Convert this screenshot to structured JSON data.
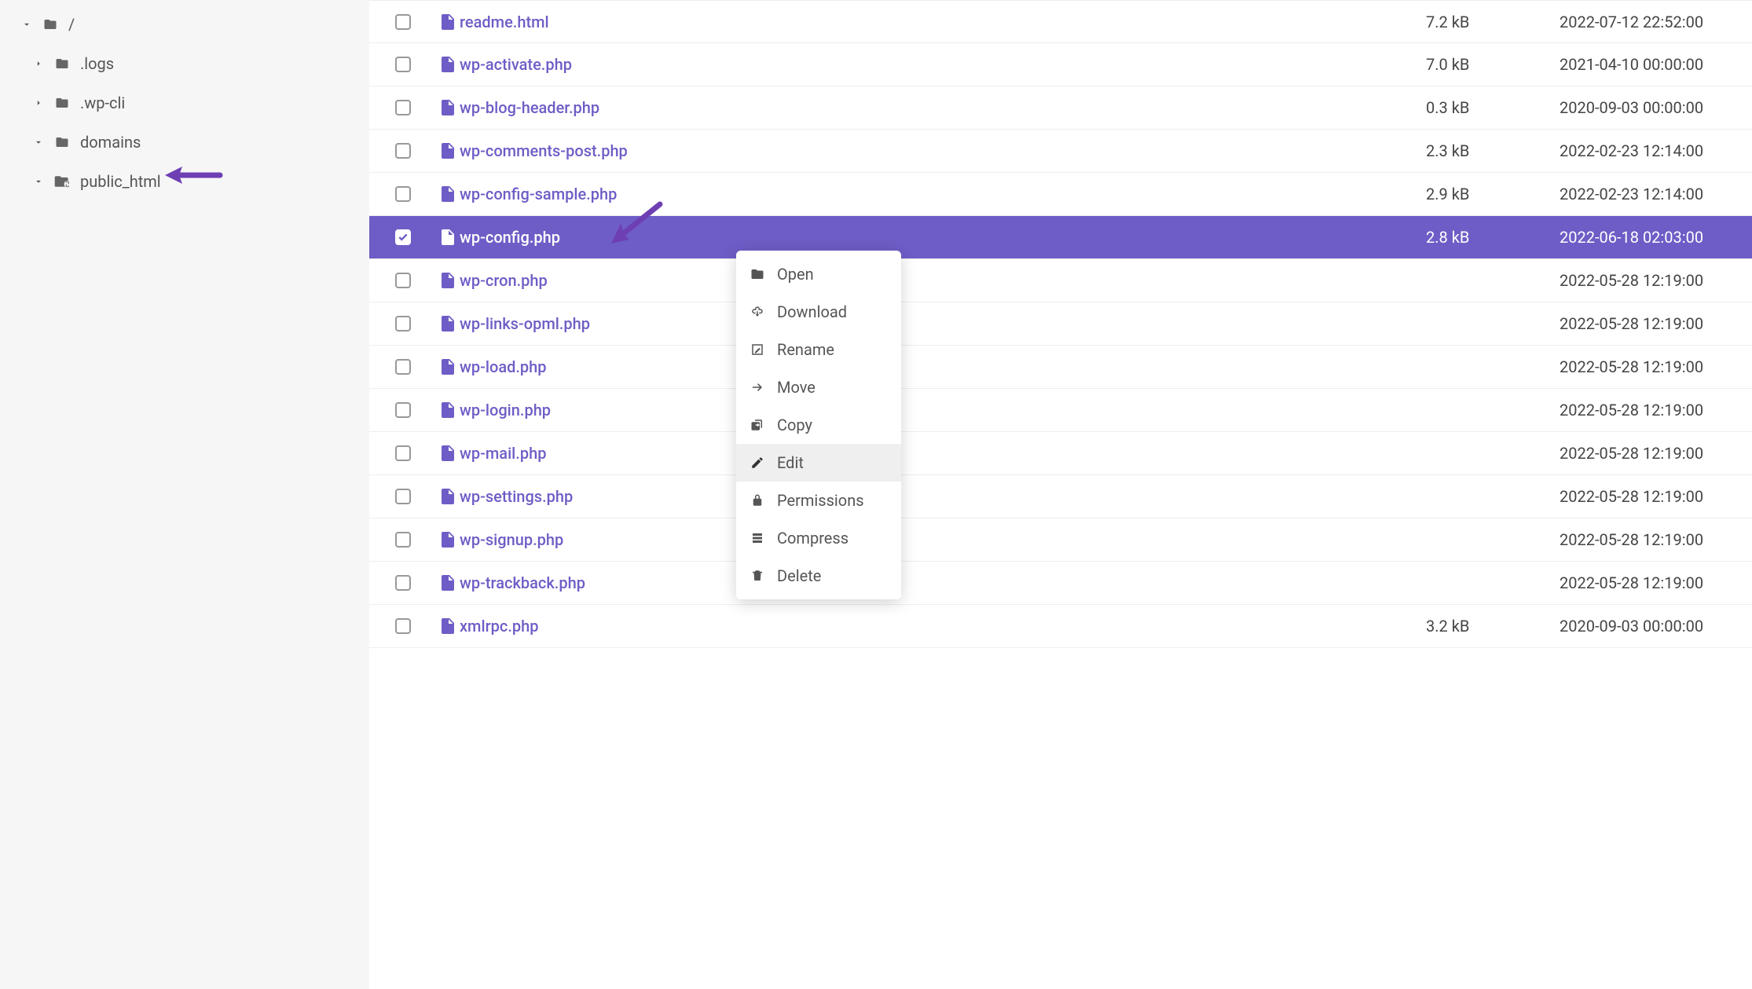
{
  "colors": {
    "accent": "#6e5dc6",
    "sidebar_bg": "#f6f6f6"
  },
  "sidebar": {
    "root_label": "/",
    "items": [
      {
        "label": ".logs",
        "expanded": false,
        "icon": "folder"
      },
      {
        "label": ".wp-cli",
        "expanded": false,
        "icon": "folder"
      },
      {
        "label": "domains",
        "expanded": true,
        "icon": "folder-open"
      },
      {
        "label": "public_html",
        "expanded": true,
        "icon": "folder-link"
      }
    ]
  },
  "files": [
    {
      "name": "readme.html",
      "size": "7.2 kB",
      "date": "2022-07-12 22:52:00",
      "checked": false
    },
    {
      "name": "wp-activate.php",
      "size": "7.0 kB",
      "date": "2021-04-10 00:00:00",
      "checked": false
    },
    {
      "name": "wp-blog-header.php",
      "size": "0.3 kB",
      "date": "2020-09-03 00:00:00",
      "checked": false
    },
    {
      "name": "wp-comments-post.php",
      "size": "2.3 kB",
      "date": "2022-02-23 12:14:00",
      "checked": false
    },
    {
      "name": "wp-config-sample.php",
      "size": "2.9 kB",
      "date": "2022-02-23 12:14:00",
      "checked": false
    },
    {
      "name": "wp-config.php",
      "size": "2.8 kB",
      "date": "2022-06-18 02:03:00",
      "checked": true,
      "selected": true
    },
    {
      "name": "wp-cron.php",
      "size": "",
      "date": "2022-05-28 12:19:00",
      "checked": false
    },
    {
      "name": "wp-links-opml.php",
      "size": "",
      "date": "2022-05-28 12:19:00",
      "checked": false
    },
    {
      "name": "wp-load.php",
      "size": "",
      "date": "2022-05-28 12:19:00",
      "checked": false
    },
    {
      "name": "wp-login.php",
      "size": "",
      "date": "2022-05-28 12:19:00",
      "checked": false
    },
    {
      "name": "wp-mail.php",
      "size": "",
      "date": "2022-05-28 12:19:00",
      "checked": false
    },
    {
      "name": "wp-settings.php",
      "size": "",
      "date": "2022-05-28 12:19:00",
      "checked": false
    },
    {
      "name": "wp-signup.php",
      "size": "",
      "date": "2022-05-28 12:19:00",
      "checked": false
    },
    {
      "name": "wp-trackback.php",
      "size": "",
      "date": "2022-05-28 12:19:00",
      "checked": false
    },
    {
      "name": "xmlrpc.php",
      "size": "3.2 kB",
      "date": "2020-09-03 00:00:00",
      "checked": false
    }
  ],
  "context_menu": {
    "items": [
      {
        "label": "Open",
        "icon": "open-icon"
      },
      {
        "label": "Download",
        "icon": "download-icon"
      },
      {
        "label": "Rename",
        "icon": "rename-icon"
      },
      {
        "label": "Move",
        "icon": "move-icon"
      },
      {
        "label": "Copy",
        "icon": "copy-icon"
      },
      {
        "label": "Edit",
        "icon": "edit-icon",
        "hovered": true
      },
      {
        "label": "Permissions",
        "icon": "permissions-icon"
      },
      {
        "label": "Compress",
        "icon": "compress-icon"
      },
      {
        "label": "Delete",
        "icon": "delete-icon"
      }
    ]
  }
}
